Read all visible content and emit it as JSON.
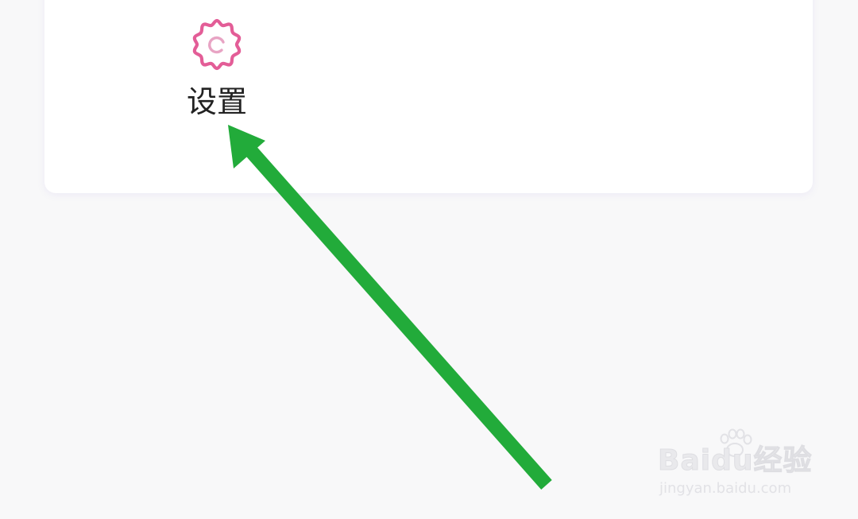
{
  "settings": {
    "label": "设置",
    "icon": "gear-icon",
    "icon_color": "#e35d97"
  },
  "annotation": {
    "type": "arrow",
    "color": "#22ab3a",
    "points_to": "settings-item"
  },
  "watermark": {
    "brand": "Baidu经验",
    "url": "jingyan.baidu.com",
    "icon": "paw-icon"
  },
  "colors": {
    "page_background": "#f8f8f9",
    "card_background": "#ffffff",
    "text": "#222222"
  }
}
